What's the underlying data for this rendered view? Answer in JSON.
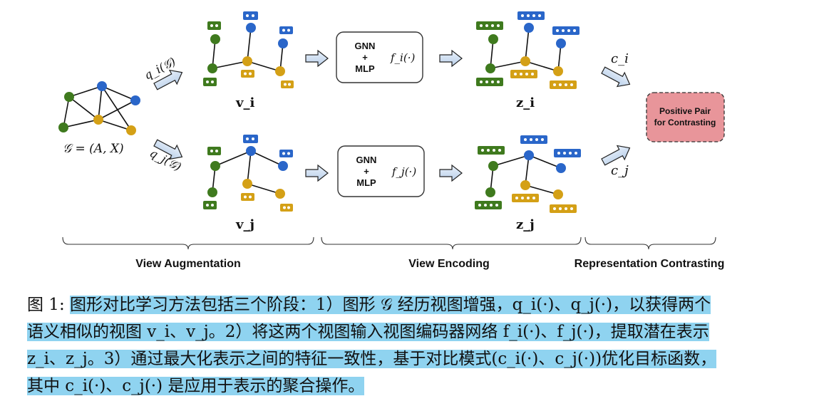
{
  "input_graph_label": "𝒢 = (A, X)",
  "aug_top_label": "q_i(𝒢)",
  "aug_bottom_label": "q_j(𝒢)",
  "view_top_label": "v_i",
  "view_bottom_label": "v_j",
  "encoder_top": {
    "line1": "GNN",
    "line2": "+",
    "line3": "MLP",
    "func": "f_i(·)"
  },
  "encoder_bottom": {
    "line1": "GNN",
    "line2": "+",
    "line3": "MLP",
    "func": "f_j(·)"
  },
  "z_top_label": "z_i",
  "z_bottom_label": "z_j",
  "c_top_label": "c_i",
  "c_bottom_label": "c_j",
  "positive_pair": {
    "line1": "Positive Pair",
    "line2": "for Contrasting"
  },
  "stages": {
    "augmentation": "View Augmentation",
    "encoding": "View Encoding",
    "contrasting": "Representation Contrasting"
  },
  "colors": {
    "green": "#3f7a1e",
    "blue": "#2a66c9",
    "gold": "#d4a016",
    "positive_fill": "#e8959a",
    "highlight": "#8fd3f0"
  },
  "caption": {
    "prefix": "图 1:",
    "line1": "图形对比学习方法包括三个阶段：1）图形 𝒢 经历视图增强，q_i(·)、q_j(·)，以获得两个",
    "line2": "语义相似的视图 v_i、v_j。2）将这两个视图输入视图编码器网络 f_i(·)、f_j(·)，提取潜在表示",
    "line3": "z_i、z_j。3）通过最大化表示之间的特征一致性，基于对比模式(c_i(·)、c_j(·))优化目标函数，",
    "line4": "其中 c_i(·)、c_j(·) 是应用于表示的聚合操作。"
  }
}
